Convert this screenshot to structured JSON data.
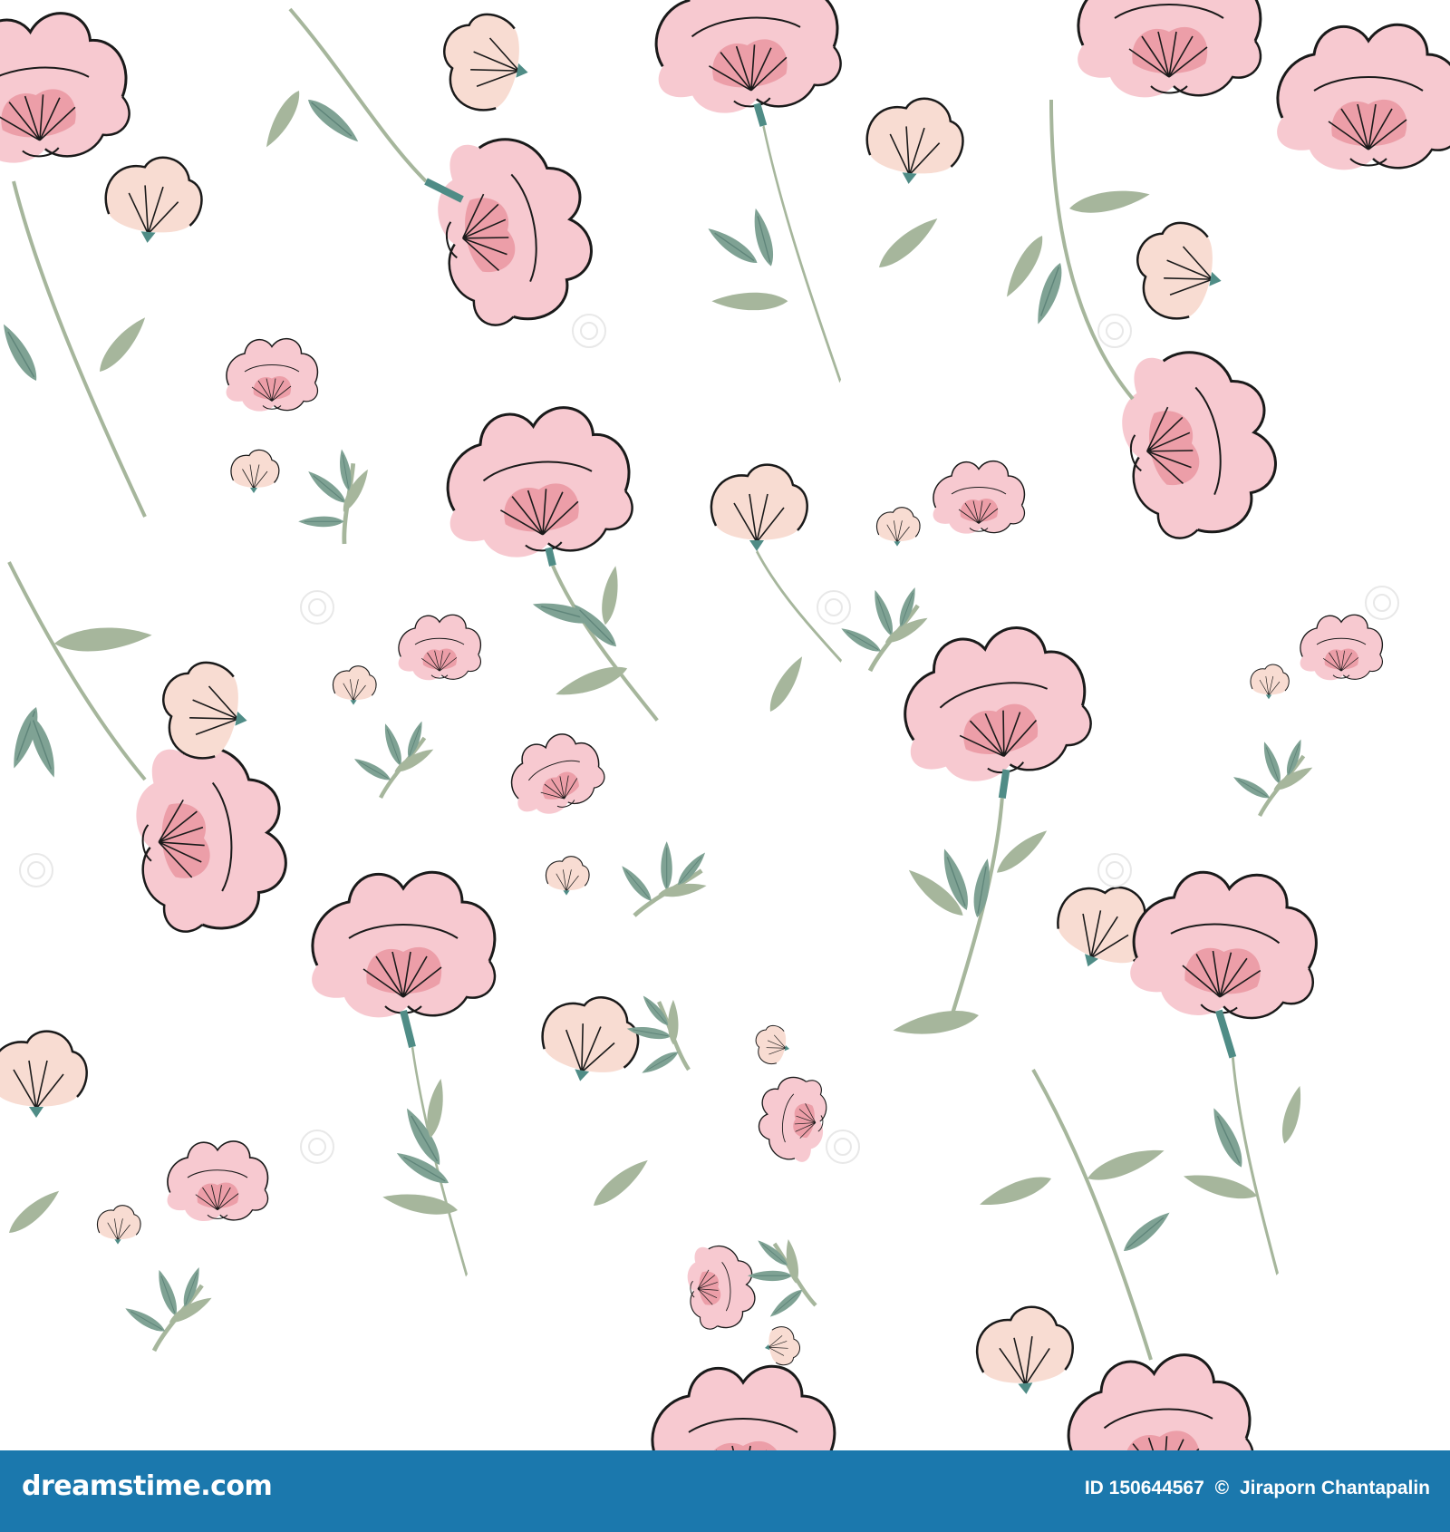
{
  "image": {
    "subject": "seamless floral pattern",
    "background_color": "#ffffff",
    "palette": {
      "petal_pink": "#f7c9d0",
      "petal_center": "#ec9ea8",
      "bud_peach": "#f8dcd2",
      "leaf_sage": "#a6b69c",
      "leaf_teal": "#6f9c8e",
      "stem_teal": "#4f8c86",
      "outline": "#1a1a1a"
    }
  },
  "footer": {
    "background_color": "#1b78ad",
    "logo_text": "dreamstime.com",
    "image_id": "ID 150644567",
    "copyright_symbol": "©",
    "author": "Jiraporn Chantapalin"
  }
}
